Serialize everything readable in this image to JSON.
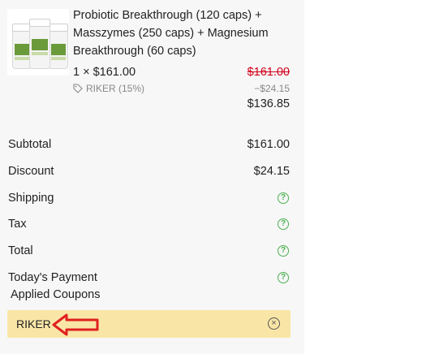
{
  "product": {
    "title": "Probiotic Breakthrough (120 caps) + Masszymes (250 caps) + Magnesium Breakthrough (60 caps)",
    "quantity_price": "1 × $161.00",
    "original_price": "$161.00",
    "coupon_tag": "RIKER (15%)",
    "discount_amount": "−$24.15",
    "final_price": "$136.85",
    "image_icon": "product-bottles-image",
    "tag_icon": "tag-icon"
  },
  "summary": {
    "subtotal_label": "Subtotal",
    "subtotal_value": "$161.00",
    "discount_label": "Discount",
    "discount_value": "$24.15",
    "shipping_label": "Shipping",
    "tax_label": "Tax",
    "total_label": "Total",
    "todays_payment_label": "Today's Payment",
    "help_icon": "question-icon",
    "help_glyph": "?"
  },
  "coupons": {
    "heading": "Applied Coupons",
    "code": "RIKER",
    "remove_glyph": "×",
    "remove_icon": "close-circle-icon"
  },
  "colors": {
    "panel_bg": "#f7f7f7",
    "strike_red": "#d0021b",
    "help_green": "#4caf50",
    "coupon_bg": "#f9e6a6",
    "annotation_arrow": "#e02020"
  }
}
